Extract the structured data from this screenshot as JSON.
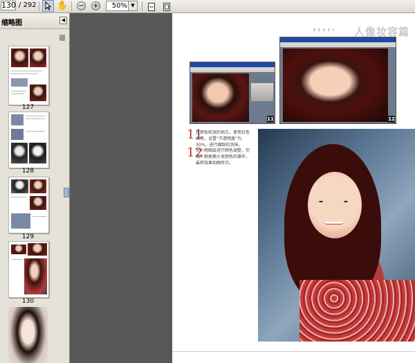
{
  "toolbar": {
    "current_page": "130",
    "total_pages": "/ 292",
    "zoom_level": "50%",
    "zoom_out_icon": "minus-circle-icon",
    "zoom_in_icon": "plus-circle-icon"
  },
  "sidebar": {
    "title": "缩略图",
    "thumbnails": [
      {
        "page": "127"
      },
      {
        "page": "128"
      },
      {
        "page": "129"
      },
      {
        "page": "130",
        "selected": true
      },
      {
        "page": ""
      }
    ]
  },
  "document": {
    "header_text": "人像妆容篇",
    "steps": [
      {
        "number": "11",
        "text": "在颜色较深的地方，使用白色画笔，设置“不透明度”为30%，进行细致的涂抹。"
      },
      {
        "number": "12",
        "text": "对人物图层进行颜色调整，完成人物更换头发颜色的操作，最终效果如图所示。"
      }
    ],
    "screenshot_badges": [
      "11",
      "12"
    ]
  },
  "colors": {
    "page_background": "#585858",
    "sidebar_background": "#e5e2d9",
    "step_number_color": "#b7312c",
    "header_text_color": "#c9c9c9"
  }
}
